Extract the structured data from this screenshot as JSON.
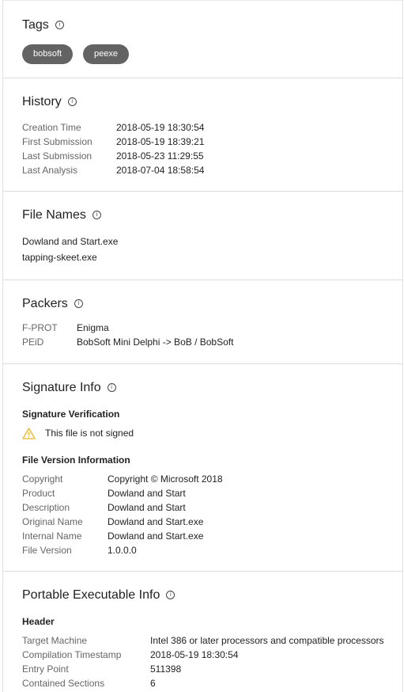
{
  "tags": {
    "title": "Tags",
    "items": [
      "bobsoft",
      "peexe"
    ]
  },
  "history": {
    "title": "History",
    "rows": [
      {
        "k": "Creation Time",
        "v": "2018-05-19 18:30:54"
      },
      {
        "k": "First Submission",
        "v": "2018-05-19 18:39:21"
      },
      {
        "k": "Last Submission",
        "v": "2018-05-23 11:29:55"
      },
      {
        "k": "Last Analysis",
        "v": "2018-07-04 18:58:54"
      }
    ]
  },
  "file_names": {
    "title": "File Names",
    "items": [
      "Dowland and Start.exe",
      "tapping-skeet.exe"
    ]
  },
  "packers": {
    "title": "Packers",
    "rows": [
      {
        "k": "F-PROT",
        "v": "Enigma"
      },
      {
        "k": "PEiD",
        "v": "BobSoft Mini Delphi -> BoB / BobSoft"
      }
    ]
  },
  "signature": {
    "title": "Signature Info",
    "verification_label": "Signature Verification",
    "warning_text": "This file is not signed",
    "version_label": "File Version Information",
    "rows": [
      {
        "k": "Copyright",
        "v": "Copyright © Microsoft 2018"
      },
      {
        "k": "Product",
        "v": "Dowland and Start"
      },
      {
        "k": "Description",
        "v": "Dowland and Start"
      },
      {
        "k": "Original Name",
        "v": "Dowland and Start.exe"
      },
      {
        "k": "Internal Name",
        "v": "Dowland and Start.exe"
      },
      {
        "k": "File Version",
        "v": "1.0.0.0"
      }
    ]
  },
  "pe": {
    "title": "Portable Executable Info",
    "header_label": "Header",
    "rows": [
      {
        "k": "Target Machine",
        "v": "Intel 386 or later processors and compatible processors"
      },
      {
        "k": "Compilation Timestamp",
        "v": "2018-05-19 18:30:54"
      },
      {
        "k": "Entry Point",
        "v": "511398"
      },
      {
        "k": "Contained Sections",
        "v": "6"
      }
    ]
  },
  "icons": {
    "info": "info-icon",
    "warning": "warning-icon"
  },
  "colors": {
    "tag_bg": "#636363",
    "warning": "#f0b429",
    "label": "#666666"
  }
}
